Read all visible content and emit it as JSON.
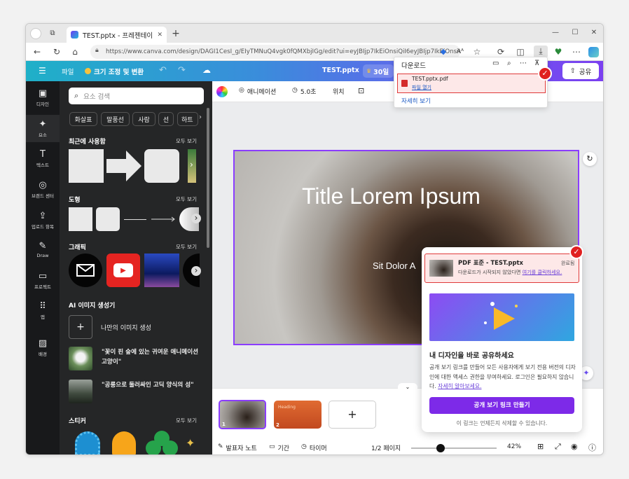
{
  "browser": {
    "tab_title": "TEST.pptx - 프레젠테이션",
    "tab_close": "✕",
    "new_tab": "+",
    "url": "https://www.canva.com/design/DAGI1CesI_g/EIyTMNuQ4vgk0fQMXbjIGg/edit?ui=eyJBIjp7IkEiOnsiQiI6eyJBIjp7IkEiOnsiQiI6ZF9WZGZfc3R...",
    "window_controls": [
      "—",
      "☐",
      "✕"
    ]
  },
  "canva_header": {
    "menu_icon": "☰",
    "file": "파일",
    "resize": "크기 조정 및 변환",
    "doc_title": "TEST.pptx",
    "trial": "30일",
    "share": "공유"
  },
  "left_rail": [
    {
      "icon": "▣",
      "label": "디자인"
    },
    {
      "icon": "✦",
      "label": "요소"
    },
    {
      "icon": "T",
      "label": "텍스트"
    },
    {
      "icon": "◎",
      "label": "브랜드 센터"
    },
    {
      "icon": "⇪",
      "label": "업로드 항목"
    },
    {
      "icon": "✎",
      "label": "Draw"
    },
    {
      "icon": "▭",
      "label": "프로젝트"
    },
    {
      "icon": "⠿",
      "label": "앱"
    },
    {
      "icon": "▨",
      "label": "배경"
    }
  ],
  "elements_panel": {
    "search_placeholder": "요소 검색",
    "chips": [
      "화살표",
      "말풍선",
      "사람",
      "선",
      "하트"
    ],
    "recent": "최근에 사용함",
    "shapes": "도형",
    "graphics": "그래픽",
    "ai_images": "AI 이미지 생성기",
    "ai_create": "나만의 이미지 생성",
    "ai_item1": "\"꽃이 핀 숲에 있는 귀여운 애니메이션 고양이\"",
    "ai_item2": "\"공룡으로 둘러싸인 고딕 양식의 성\"",
    "stickers": "스티커",
    "see_all": "모두 보기"
  },
  "editor_toolbar": {
    "animate": "애니메이션",
    "duration": "5.0초",
    "position": "위치"
  },
  "slide": {
    "title": "Title Lorem Ipsum",
    "subtitle": "Sit Dolor A"
  },
  "download_popup": {
    "header": "다운로드",
    "filename": "TEST.pptx.pdf",
    "open_file": "파일 열기",
    "more": "자세히 보기"
  },
  "share_panel": {
    "item_title": "PDF 표준 - TEST.pptx",
    "status": "완료됨",
    "note_prefix": "다운로드가 시작되지 않았다면 ",
    "note_link": "여기를 클릭하세요.",
    "heading": "내 디자인을 바로 공유하세요",
    "body": "공개 보기 링크를 만들어 모든 사용자에게 보기 전용 버전의 디자인에 대한 액세스 권한을 부여하세요. 로그인은 필요하지 않습니다.",
    "learn_more": "자세히 알아보세요.",
    "button": "공개 보기 링크 만들기",
    "footer": "이 링크는 언제든지 삭제할 수 있습니다."
  },
  "bottom_bar": {
    "notes": "발표자 노트",
    "timing": "기간",
    "timer": "타이머",
    "page": "1/2 페이지",
    "zoom": "42%",
    "add_page": "+",
    "thumb1_num": "1",
    "thumb2_num": "2",
    "thumb2_label": "Heading"
  },
  "zoom_level": 0.42,
  "colors": {
    "accent": "#8b3dff",
    "check": "#e02020",
    "download_highlight": "#fde8e8"
  }
}
